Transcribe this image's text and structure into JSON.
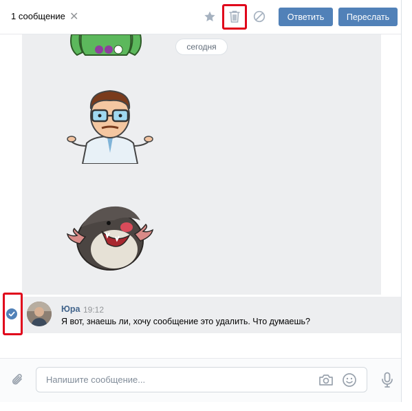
{
  "header": {
    "selected_count": "1 сообщение",
    "clear_symbol": "✕",
    "reply_label": "Ответить",
    "forward_label": "Переслать",
    "icons": [
      "star-icon",
      "trash-icon",
      "block-icon"
    ]
  },
  "feed": {
    "date_label": "сегодня",
    "stickers": [
      "green-character-sticker",
      "scientist-shrug-sticker",
      "mole-shrug-sticker"
    ]
  },
  "message": {
    "author": "Юра",
    "time": "19:12",
    "text": "Я вот, знаешь ли, хочу сообщение это удалить. Что думаешь?",
    "selected": true
  },
  "composer": {
    "placeholder": "Напишите сообщение...",
    "icons": [
      "attach-icon",
      "camera-icon",
      "emoji-icon",
      "microphone-icon"
    ]
  },
  "colors": {
    "accent": "#5181b8",
    "highlight": "#e0001a",
    "feed_bg": "#edeef0",
    "author": "#42648b"
  }
}
